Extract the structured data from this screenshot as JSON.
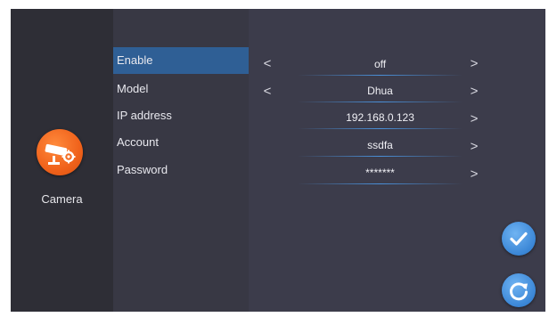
{
  "sidebar": {
    "title": "Camera",
    "icon": "cctv-camera-settings-icon"
  },
  "menu": {
    "items": [
      {
        "label": "Enable"
      },
      {
        "label": "Model"
      },
      {
        "label": "IP address"
      },
      {
        "label": "Account"
      },
      {
        "label": "Password"
      }
    ]
  },
  "fields": {
    "enable": {
      "value": "off"
    },
    "model": {
      "value": "Dhua"
    },
    "ip_address": {
      "value": "192.168.0.123"
    },
    "account": {
      "value": "ssdfa"
    },
    "password": {
      "value": "*******"
    }
  },
  "glyphs": {
    "prev": "<",
    "next": ">"
  },
  "actions": {
    "confirm_icon": "check-icon",
    "reset_icon": "refresh-icon"
  },
  "colors": {
    "accent": "#2f5f95",
    "camera_badge": "#f0621b",
    "action_button": "#3a86d6"
  }
}
